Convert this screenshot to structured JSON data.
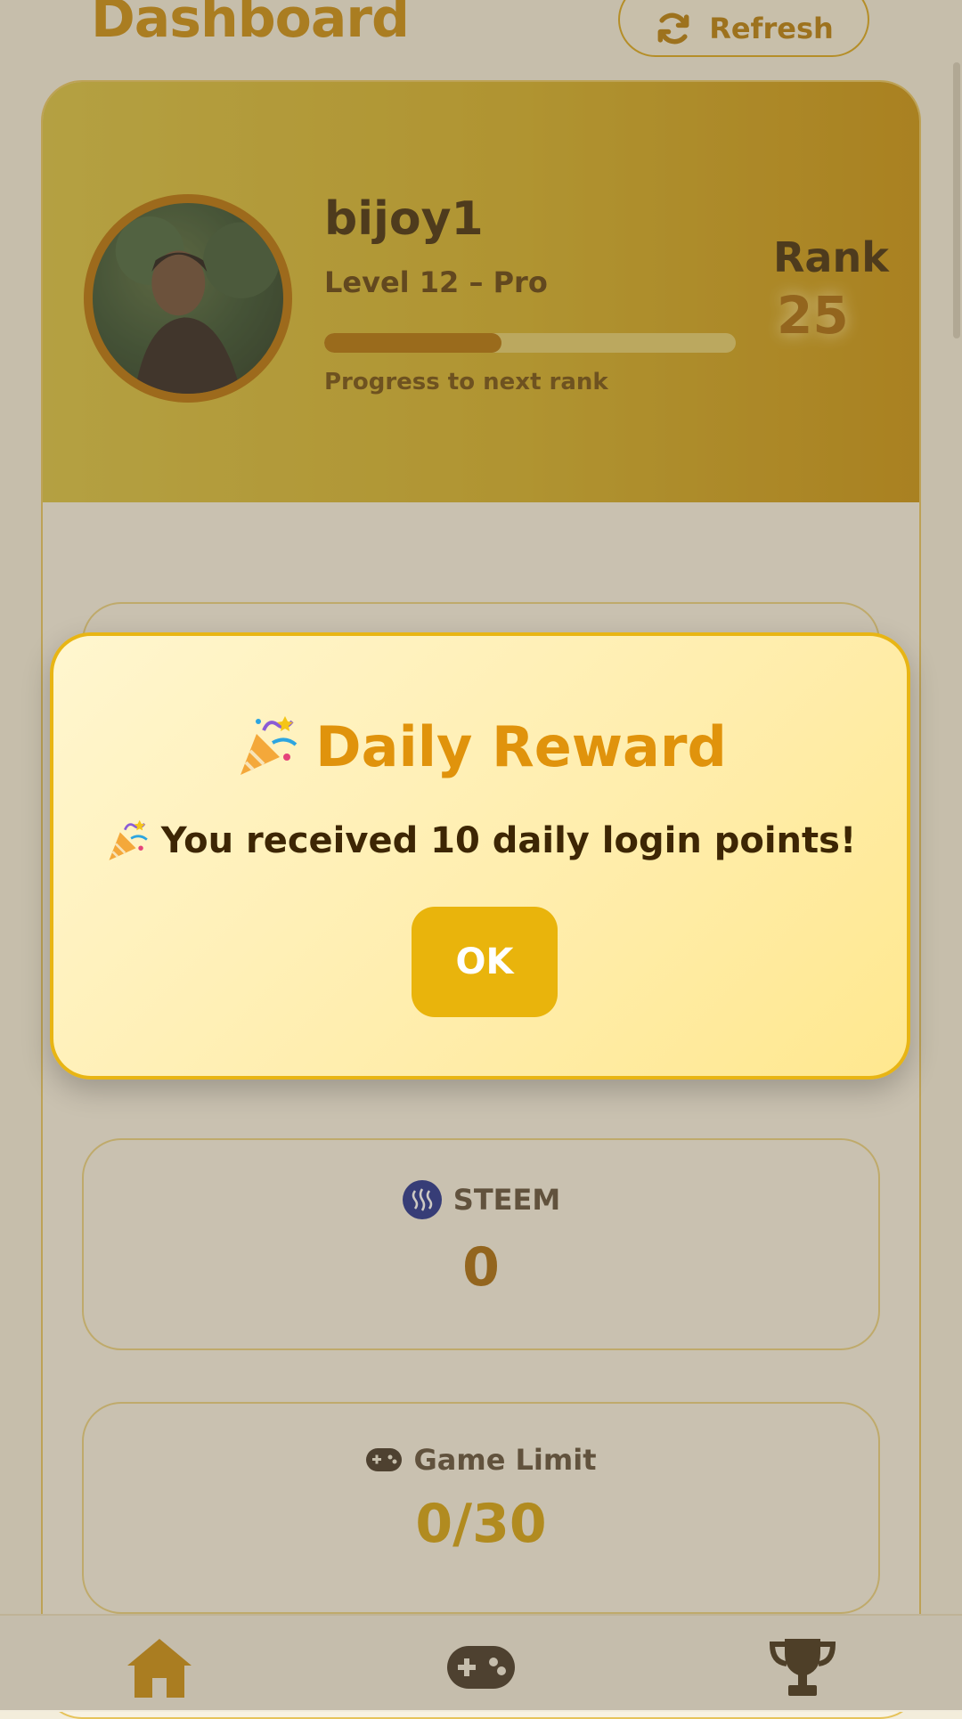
{
  "header": {
    "title": "Dashboard",
    "refresh_label": "Refresh"
  },
  "profile": {
    "username": "bijoy1",
    "level": "Level 12 – Pro",
    "progress_label": "Progress to next rank",
    "progress_fraction": 0.43,
    "rank_label": "Rank",
    "rank_value": "25"
  },
  "stats": [
    {
      "label": "STEEM",
      "value": "0",
      "icon": "steem-icon"
    },
    {
      "label": "Game Limit",
      "value": "0/30",
      "icon": "gamepad-icon"
    }
  ],
  "modal": {
    "title": "Daily Reward",
    "message": "You received 10 daily login points!",
    "ok_label": "OK"
  },
  "nav": {
    "items": [
      "home-icon",
      "gamepad-icon",
      "trophy-icon"
    ]
  },
  "colors": {
    "accent": "#e0930c",
    "brand_gold": "#e9b40c",
    "brown": "#3d2604"
  }
}
